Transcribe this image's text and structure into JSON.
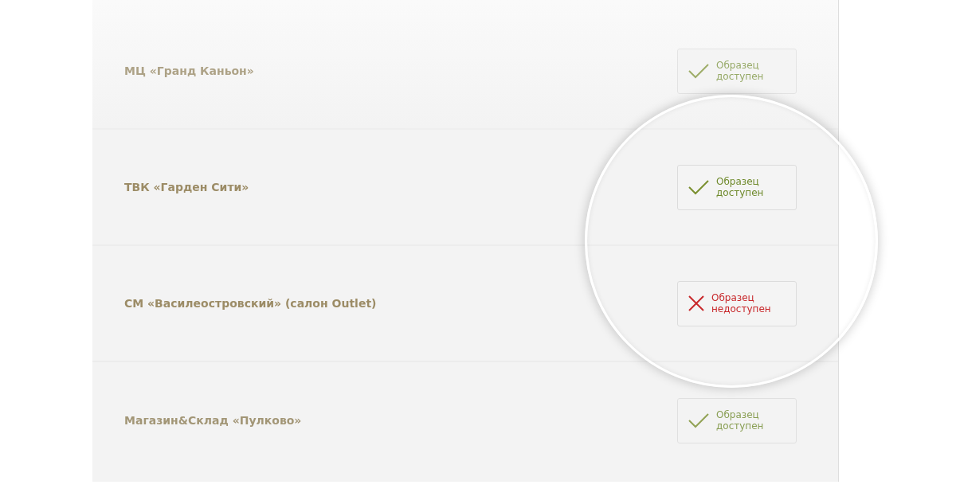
{
  "rows": [
    {
      "name": "МЦ «Гранд Каньон»",
      "in_focus": false,
      "sample": {
        "available": true,
        "label": "Образец доступен"
      }
    },
    {
      "name": "ТВК «Гарден Сити»",
      "in_focus": true,
      "sample": {
        "available": true,
        "label": "Образец доступен"
      }
    },
    {
      "name": "СМ «Василеостровский» (салон Outlet)",
      "in_focus": true,
      "sample": {
        "available": false,
        "label": "Образец недоступен"
      }
    },
    {
      "name": "Магазин&Склад «Пулково»",
      "in_focus": false,
      "sample": {
        "available": true,
        "label": "Образец доступен"
      }
    }
  ]
}
